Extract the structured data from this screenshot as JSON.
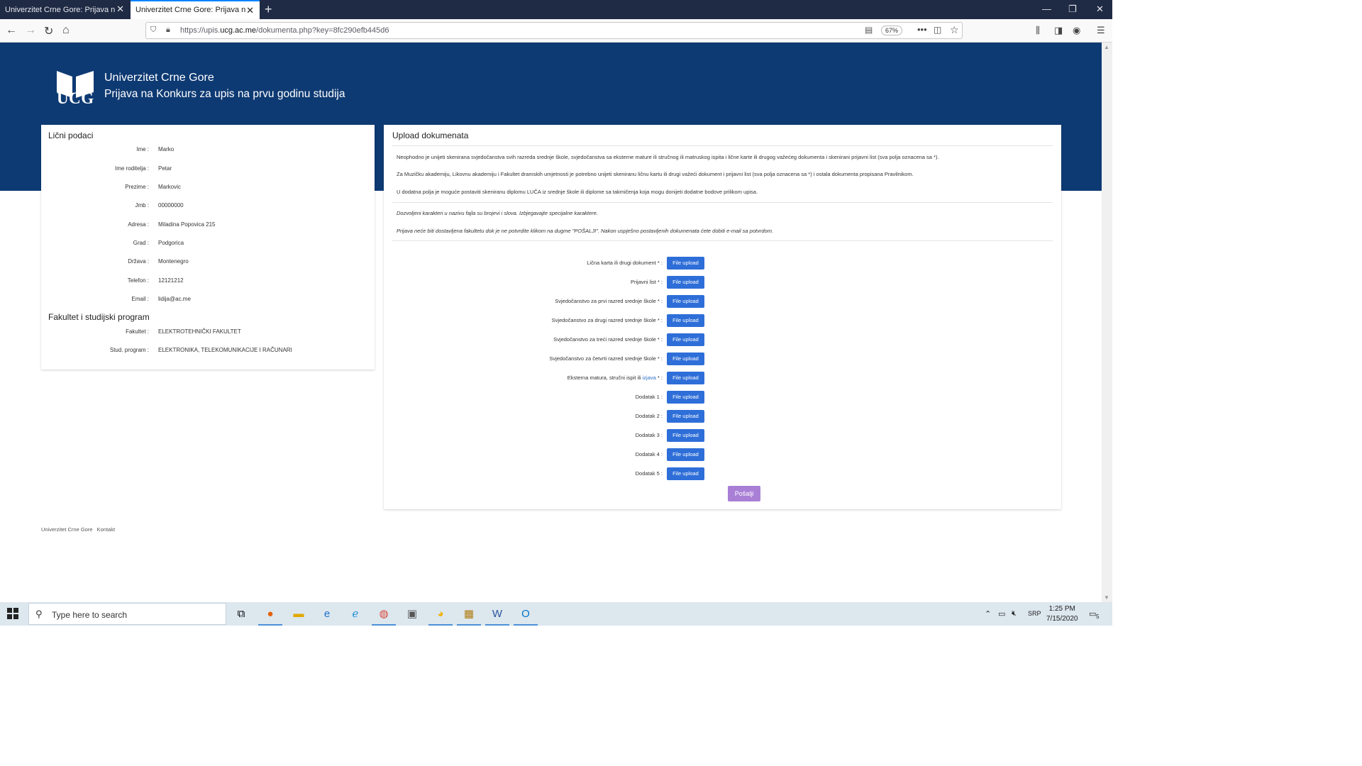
{
  "browser": {
    "tabs": [
      {
        "title": "Univerzitet Crne Gore: Prijava na Ko",
        "active": false
      },
      {
        "title": "Univerzitet Crne Gore: Prijava na Ko",
        "active": true
      }
    ],
    "url_prefix": "https://upis.",
    "url_domain": "ucg.ac.me",
    "url_path": "/dokumenta.php?key=8fc290efb445d6",
    "zoom": "67%"
  },
  "header": {
    "logo_text": "UCG",
    "title": "Univerzitet Crne Gore",
    "subtitle": "Prijava na Konkurs za upis na prvu godinu studija"
  },
  "personal": {
    "heading": "Lični podaci",
    "fields": [
      {
        "label": "Ime :",
        "value": "Marko"
      },
      {
        "label": "Ime roditelja :",
        "value": "Petar"
      },
      {
        "label": "Prezime :",
        "value": "Markovic"
      },
      {
        "label": "Jmb :",
        "value": "00000000"
      },
      {
        "label": "Adresa :",
        "value": "Miladina Popovica 215"
      },
      {
        "label": "Grad :",
        "value": "Podgorica"
      },
      {
        "label": "Država :",
        "value": "Montenegro"
      },
      {
        "label": "Telefon :",
        "value": "12121212"
      },
      {
        "label": "Email :",
        "value": "lidija@ac.me"
      }
    ]
  },
  "faculty": {
    "heading": "Fakultet i studijski program",
    "fields": [
      {
        "label": "Fakultet :",
        "value": "ELEKTROTEHNIČKI FAKULTET"
      },
      {
        "label": "Stud. program :",
        "value": "ELEKTRONIKA, TELEKOMUNIKACIJE I RAČUNARI"
      }
    ]
  },
  "upload": {
    "heading": "Upload dokumenata",
    "info": [
      "Neophodno je unijeti skenirana svjedočanstva svih razreda srednje škole, svjedočanstva sa eksterne mature ili stručnog ili matruskog ispita i lične karte ili drugog važećeg dokumenta i skenirani prijavni list (sva polja oznacena sa *).",
      "Za Muzičku akademiju, Likovnu akademiju i Fakultet dramskih umjetnosti je potrebno unijeti skeniranu ličnu kartu ili drugi važeći dokument i prijavni list (sva polja oznacena sa *) i ostala dokumenta propisana Pravilnikom.",
      "U dodatna polja je moguće postaviti skeniranu diplomu LUČA iz srednje škole ili diplome sa takmičenja koja mogu donijeti dodatne bodove prilikom upisa."
    ],
    "notes": [
      "Dozvoljeni karakteri u nazivu fajla su brojevi i slova. Izbjegavajte specijalne karaktere.",
      "Prijava neće biti dostavljena fakultetu dok je ne potvrdite klikom na dugme \"POŠALJI\". Nakon uspješno postavljenih dokumenata ćete dobiti e-mail sa potvrdom."
    ],
    "button_label": "File upload",
    "rows": [
      {
        "label": "Lična karta ili drugi dokument * :"
      },
      {
        "label": "Prijavni list * :"
      },
      {
        "label": "Svjedočanstvo za prvi razred srednje škole * :"
      },
      {
        "label": "Svjedočanstvo za drugi razred srednje škole * :"
      },
      {
        "label": "Svjedočanstvo za treći razred srednje škole * :"
      },
      {
        "label": "Svjedočanstvo za četvrti razred srednje škole * :"
      },
      {
        "label_pre": "Eksterna matura, stručni ispit ili ",
        "label_link": "izjava",
        "label_post": " * :"
      },
      {
        "label": "Dodatak 1 :"
      },
      {
        "label": "Dodatak 2 :"
      },
      {
        "label": "Dodatak 3 :"
      },
      {
        "label": "Dodatak 4 :"
      },
      {
        "label": "Dodatak 5 :"
      }
    ],
    "submit_label": "Pošalji"
  },
  "footer": {
    "links": [
      "Univerzitet Crne Gore",
      "Kontakt"
    ]
  },
  "taskbar": {
    "search_placeholder": "Type here to search",
    "lang": "SRP",
    "time": "1:25 PM",
    "date": "7/15/2020",
    "notifications": "5"
  }
}
